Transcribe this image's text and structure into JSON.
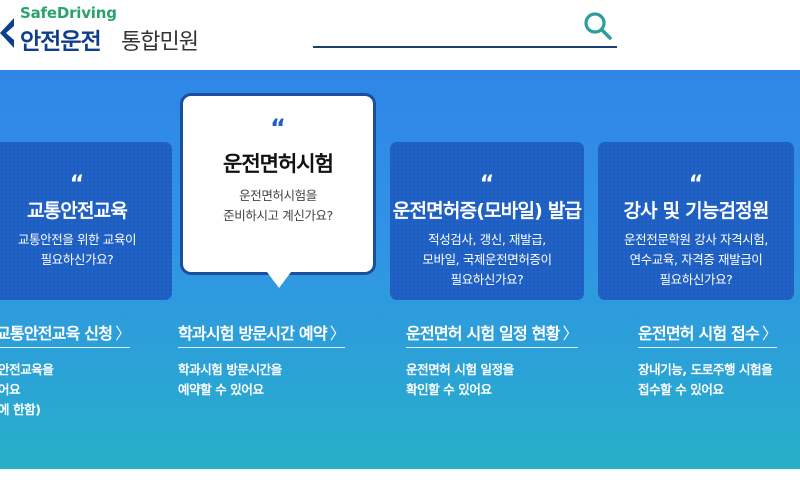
{
  "header": {
    "logo_sub": "SafeDriving",
    "logo_main": "안전운전",
    "logo_suffix": "통합민원",
    "search_placeholder": ""
  },
  "colors": {
    "brand_navy": "#0f3e8e",
    "brand_green": "#2aa36b",
    "card_blue": "#1c5ec2",
    "hero_top": "#2f86e6",
    "hero_bottom": "#27b0c6"
  },
  "cards": [
    {
      "quote": "“",
      "title": "교통안전교육",
      "desc": [
        "교통안전을 위한 교육이",
        "필요하신가요?"
      ],
      "link": "교통안전교육 신청",
      "link_desc": [
        "안전교육을",
        "어요",
        "에 한함)"
      ]
    },
    {
      "quote": "“",
      "title": "운전면허시험",
      "desc": [
        "운전면허시험을",
        "준비하시고 계신가요?"
      ],
      "link": "학과시험 방문시간 예약",
      "link_desc": [
        "학과시험 방문시간을",
        "예약할 수 있어요"
      ]
    },
    {
      "quote": "“",
      "title": "운전면허증(모바일) 발급",
      "desc": [
        "적성검사, 갱신, 재발급,",
        "모바일, 국제운전면허증이",
        "필요하신가요?"
      ],
      "link": "운전면허 시험 일정 현황",
      "link_desc": [
        "운전면허 시험 일정을",
        "확인할 수 있어요"
      ]
    },
    {
      "quote": "“",
      "title": "강사 및 기능검정원",
      "desc": [
        "운전전문학원 강사 자격시험,",
        "연수교육, 자격증 재발급이",
        "필요하신가요?"
      ],
      "link": "운전면허 시험 접수",
      "link_desc": [
        "장내기능, 도로주행 시험을",
        "접수할 수 있어요"
      ]
    }
  ],
  "chevron": "〉"
}
